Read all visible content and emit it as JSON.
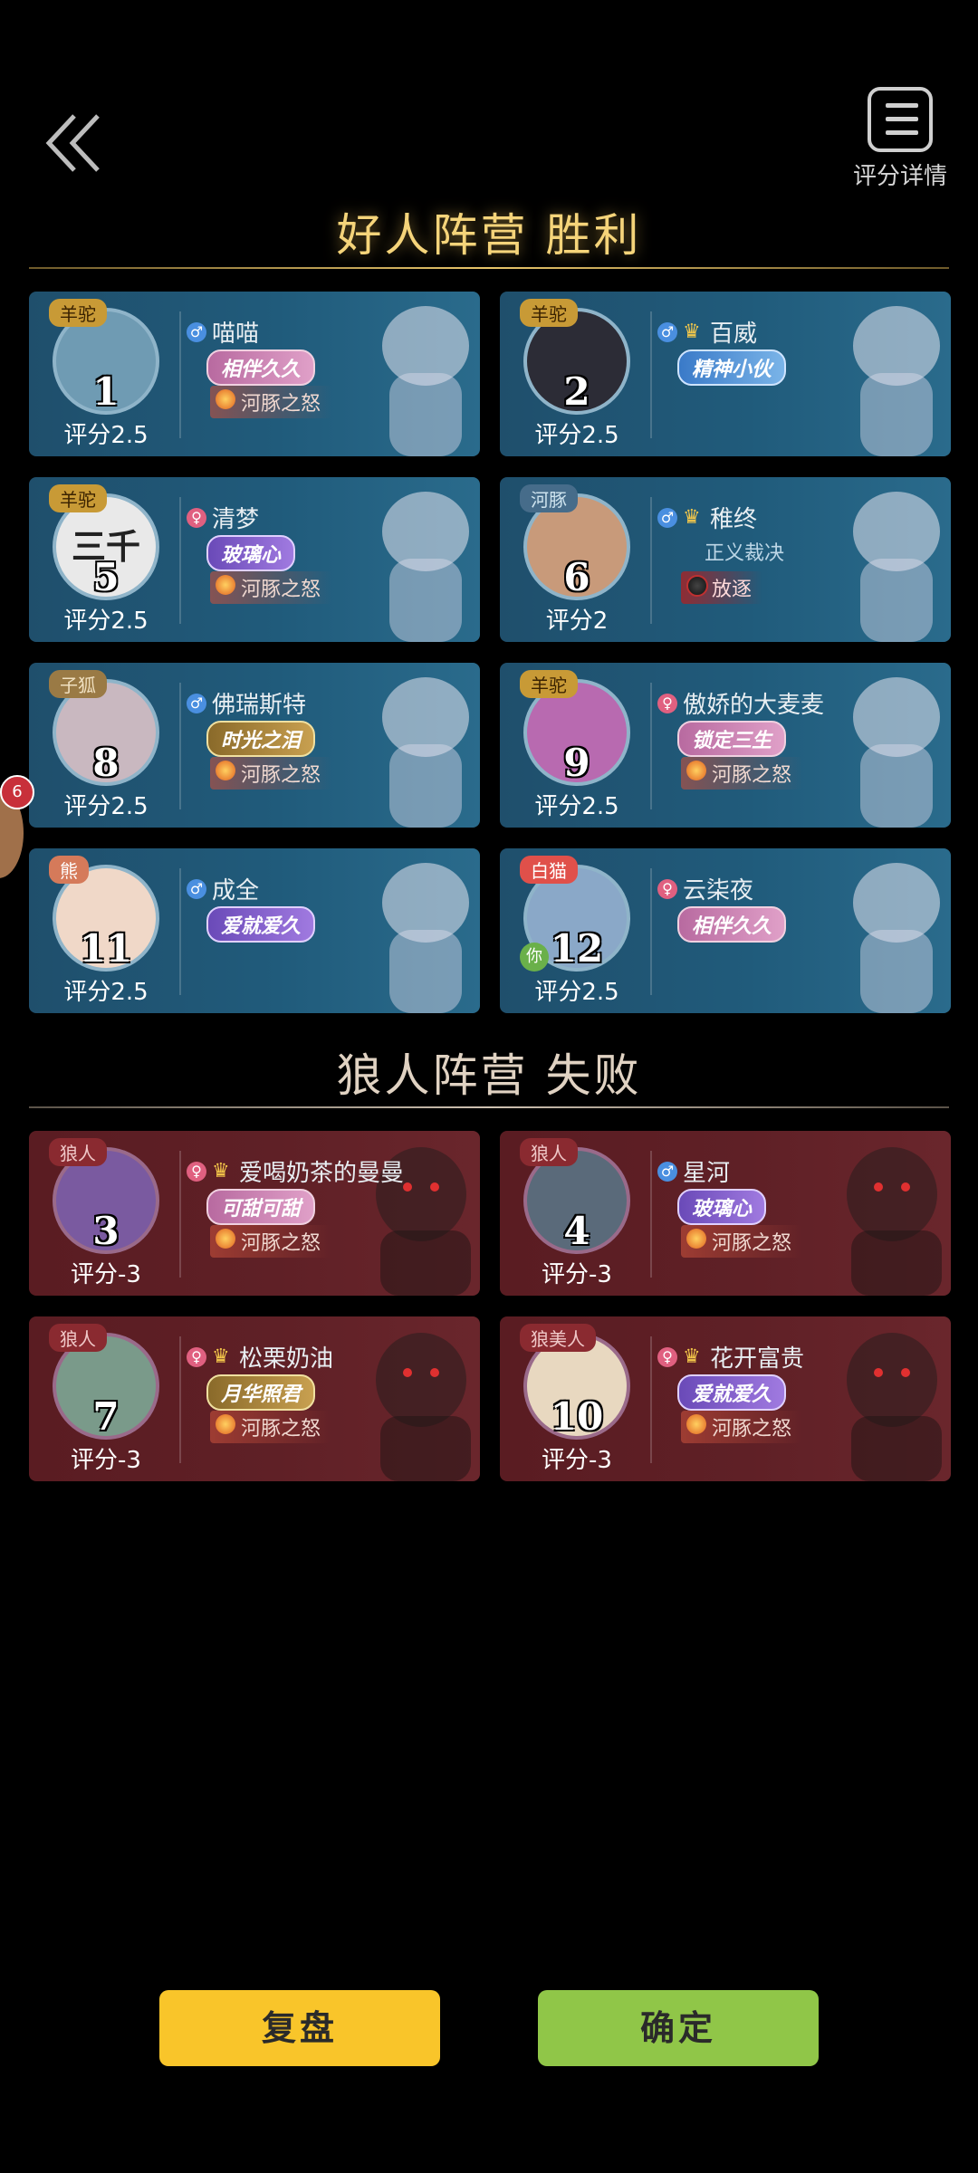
{
  "header": {
    "detail_label": "评分详情"
  },
  "good_camp": {
    "title": "好人阵营  胜利",
    "players": [
      {
        "seat": "1",
        "role": "羊驼",
        "role_class": "",
        "gender": "♂",
        "gender_class": "g-m",
        "crown": false,
        "name": "喵喵",
        "badge": "相伴久久",
        "badge_class": "",
        "skill": "河豚之怒",
        "skill_class": "",
        "score": "评分2.5",
        "avatar": "#6f9bb3",
        "you": false
      },
      {
        "seat": "2",
        "role": "羊驼",
        "role_class": "",
        "gender": "♂",
        "gender_class": "g-m",
        "crown": true,
        "name": "百威",
        "badge": "精神小伙",
        "badge_class": "blue",
        "skill": "",
        "skill_class": "",
        "score": "评分2.5",
        "avatar": "#2c2c36",
        "you": false
      },
      {
        "seat": "5",
        "role": "羊驼",
        "role_class": "",
        "gender": "♀",
        "gender_class": "g-f",
        "crown": false,
        "name": "清梦",
        "badge": "玻璃心",
        "badge_class": "purple",
        "skill": "河豚之怒",
        "skill_class": "",
        "score": "评分2.5",
        "avatar": "#e9e9e9",
        "avatar_text": "三千",
        "you": false
      },
      {
        "seat": "6",
        "role": "河豚",
        "role_class": "fish",
        "gender": "♂",
        "gender_class": "g-m",
        "crown": true,
        "name": "稚终",
        "badge": "正义裁决",
        "badge_class": "plain",
        "skill": "放逐",
        "skill_class": "dark",
        "score": "评分2",
        "avatar": "#c89a7a",
        "you": false
      },
      {
        "seat": "8",
        "role": "子狐",
        "role_class": "fox",
        "gender": "♂",
        "gender_class": "g-m",
        "crown": false,
        "name": "佛瑞斯特",
        "badge": "时光之泪",
        "badge_class": "gold",
        "skill": "河豚之怒",
        "skill_class": "",
        "score": "评分2.5",
        "avatar": "#c9b8c0",
        "you": false
      },
      {
        "seat": "9",
        "role": "羊驼",
        "role_class": "",
        "gender": "♀",
        "gender_class": "g-f",
        "crown": false,
        "name": "傲娇的大麦麦",
        "badge": "锁定三生",
        "badge_class": "",
        "skill": "河豚之怒",
        "skill_class": "",
        "score": "评分2.5",
        "avatar": "#b86ab0",
        "you": false
      },
      {
        "seat": "11",
        "role": "熊",
        "role_class": "bear",
        "gender": "♂",
        "gender_class": "g-m",
        "crown": false,
        "name": "成全",
        "badge": "爱就爱久",
        "badge_class": "purple",
        "skill": "",
        "skill_class": "",
        "score": "评分2.5",
        "avatar": "#f0d8c8",
        "you": false
      },
      {
        "seat": "12",
        "role": "白猫",
        "role_class": "cat",
        "gender": "♀",
        "gender_class": "g-f",
        "crown": false,
        "name": "云柒夜",
        "badge": "相伴久久",
        "badge_class": "",
        "skill": "",
        "skill_class": "",
        "score": "评分2.5",
        "avatar": "#8aa8c8",
        "you": true,
        "you_label": "你"
      }
    ]
  },
  "bad_camp": {
    "title": "狼人阵营  失败",
    "players": [
      {
        "seat": "3",
        "role": "狼人",
        "gender": "♀",
        "gender_class": "g-f",
        "crown": true,
        "name": "爱喝奶茶的曼曼",
        "badge": "可甜可甜",
        "badge_class": "",
        "skill": "河豚之怒",
        "score": "评分-3",
        "avatar": "#7a5aa0"
      },
      {
        "seat": "4",
        "role": "狼人",
        "gender": "♂",
        "gender_class": "g-m",
        "crown": false,
        "name": "星河",
        "badge": "玻璃心",
        "badge_class": "purple",
        "skill": "河豚之怒",
        "score": "评分-3",
        "avatar": "#5a6a7a"
      },
      {
        "seat": "7",
        "role": "狼人",
        "gender": "♀",
        "gender_class": "g-f",
        "crown": true,
        "name": "松栗奶油",
        "badge": "月华照君",
        "badge_class": "gold",
        "skill": "河豚之怒",
        "score": "评分-3",
        "avatar": "#7a9a8a"
      },
      {
        "seat": "10",
        "role": "狼美人",
        "gender": "♀",
        "gender_class": "g-f",
        "crown": true,
        "name": "花开富贵",
        "badge": "爱就爱久",
        "badge_class": "purple",
        "skill": "河豚之怒",
        "score": "评分-3",
        "avatar": "#e8d8c0"
      }
    ]
  },
  "side_indicator": "6",
  "buttons": {
    "replay": "复盘",
    "confirm": "确定"
  }
}
